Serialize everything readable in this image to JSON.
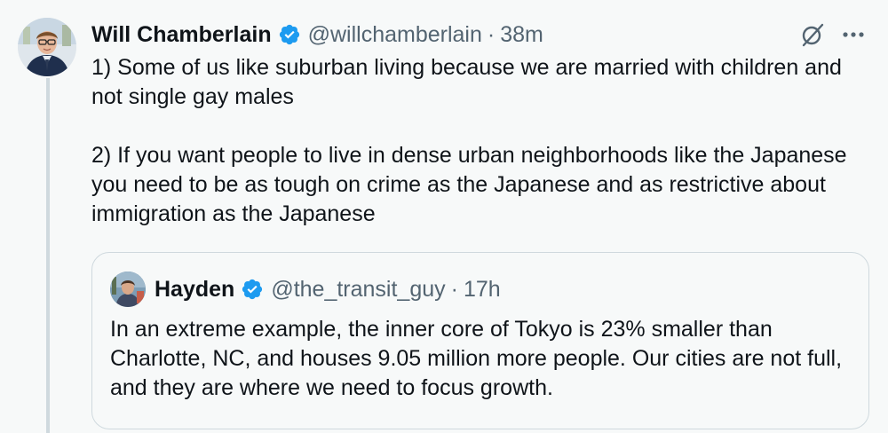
{
  "tweet": {
    "author_name": "Will Chamberlain",
    "handle": "@willchamberlain",
    "separator": "·",
    "time": "38m",
    "paragraphs": [
      "1) Some of us like suburban living because we are married with children and not single gay males",
      "2) If you want people to live in dense urban neighborhoods like the Japanese you need to be as tough on crime as the Japanese and as restrictive about immigration as the Japanese"
    ],
    "icons": {
      "verified": "verified-badge-icon",
      "grok": "grok-icon",
      "more": "more-icon"
    }
  },
  "quoted_tweet": {
    "author_name": "Hayden",
    "handle": "@the_transit_guy",
    "separator": "·",
    "time": "17h",
    "text": "In an extreme example, the inner core of Tokyo is 23% smaller than Charlotte, NC, and houses 9.05 million more people. Our cities are not full, and they are where we need to focus growth."
  },
  "colors": {
    "background": "#f7f9f9",
    "text": "#0f1419",
    "secondary_text": "#536471",
    "verified_blue": "#1d9bf0",
    "border": "#cfd9de"
  }
}
